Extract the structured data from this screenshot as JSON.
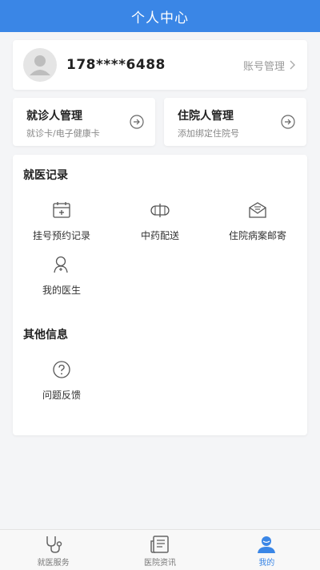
{
  "header": {
    "title": "个人中心"
  },
  "profile": {
    "phone": "178****6488",
    "account_label": "账号管理"
  },
  "managers": [
    {
      "title": "就诊人管理",
      "subtitle": "就诊卡/电子健康卡"
    },
    {
      "title": "住院人管理",
      "subtitle": "添加绑定住院号"
    }
  ],
  "records": {
    "title": "就医记录",
    "items": [
      {
        "label": "挂号预约记录",
        "icon": "calendar-plus-icon"
      },
      {
        "label": "中药配送",
        "icon": "herb-capsule-icon"
      },
      {
        "label": "住院病案邮寄",
        "icon": "mail-envelope-icon"
      },
      {
        "label": "我的医生",
        "icon": "doctor-icon"
      }
    ]
  },
  "other": {
    "title": "其他信息",
    "items": [
      {
        "label": "问题反馈",
        "icon": "question-icon"
      }
    ]
  },
  "tabs": [
    {
      "label": "就医服务",
      "icon": "stethoscope-icon",
      "active": false
    },
    {
      "label": "医院资讯",
      "icon": "news-icon",
      "active": false
    },
    {
      "label": "我的",
      "icon": "user-icon",
      "active": true
    }
  ],
  "colors": {
    "primary": "#3a86e6",
    "background": "#f4f5f7"
  }
}
